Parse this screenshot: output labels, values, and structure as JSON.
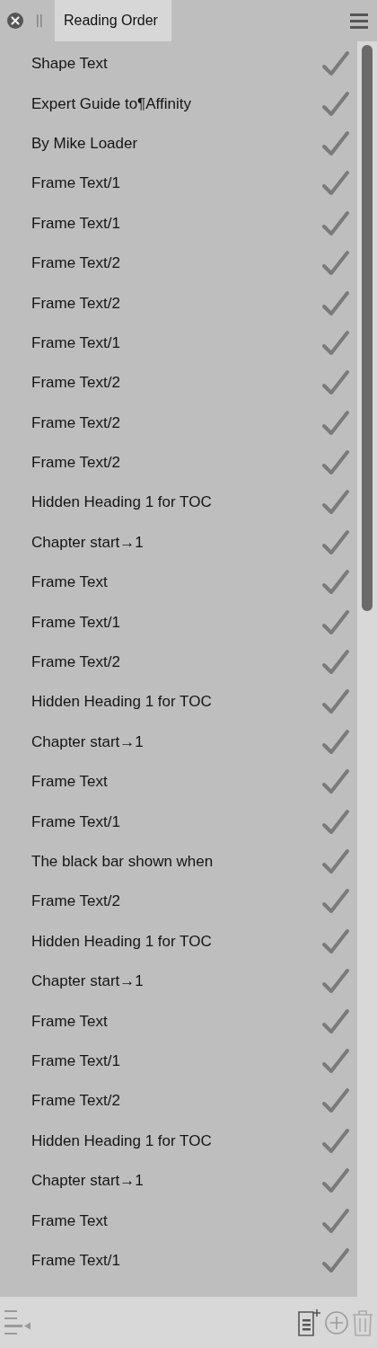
{
  "panel": {
    "tab": {
      "label": "Reading Order",
      "selected": true
    }
  },
  "items": [
    {
      "label": "Shape Text",
      "checked": true
    },
    {
      "label": "Expert Guide to¶Affinity",
      "checked": true
    },
    {
      "label": "By Mike Loader",
      "checked": true
    },
    {
      "label": "Frame Text/1",
      "checked": true
    },
    {
      "label": "Frame Text/1",
      "checked": true
    },
    {
      "label": "Frame Text/2",
      "checked": true
    },
    {
      "label": "Frame Text/2",
      "checked": true
    },
    {
      "label": "Frame Text/1",
      "checked": true
    },
    {
      "label": "Frame Text/2",
      "checked": true
    },
    {
      "label": "Frame Text/2",
      "checked": true
    },
    {
      "label": "Frame Text/2",
      "checked": true
    },
    {
      "label": "Hidden Heading 1 for TOC",
      "checked": true
    },
    {
      "label": "Chapter start→1",
      "checked": true
    },
    {
      "label": "Frame Text",
      "checked": true
    },
    {
      "label": "Frame Text/1",
      "checked": true
    },
    {
      "label": "Frame Text/2",
      "checked": true
    },
    {
      "label": "Hidden Heading 1 for TOC",
      "checked": true
    },
    {
      "label": "Chapter start→1",
      "checked": true
    },
    {
      "label": "Frame Text",
      "checked": true
    },
    {
      "label": "Frame Text/1",
      "checked": true
    },
    {
      "label": "The black bar shown when",
      "checked": true
    },
    {
      "label": "Frame Text/2",
      "checked": true
    },
    {
      "label": "Hidden Heading 1 for TOC",
      "checked": true
    },
    {
      "label": "Chapter start→1",
      "checked": true
    },
    {
      "label": "Frame Text",
      "checked": true
    },
    {
      "label": "Frame Text/1",
      "checked": true
    },
    {
      "label": "Frame Text/2",
      "checked": true
    },
    {
      "label": "Hidden Heading 1 for TOC",
      "checked": true
    },
    {
      "label": "Chapter start→1",
      "checked": true
    },
    {
      "label": "Frame Text",
      "checked": true
    },
    {
      "label": "Frame Text/1",
      "checked": true
    }
  ]
}
